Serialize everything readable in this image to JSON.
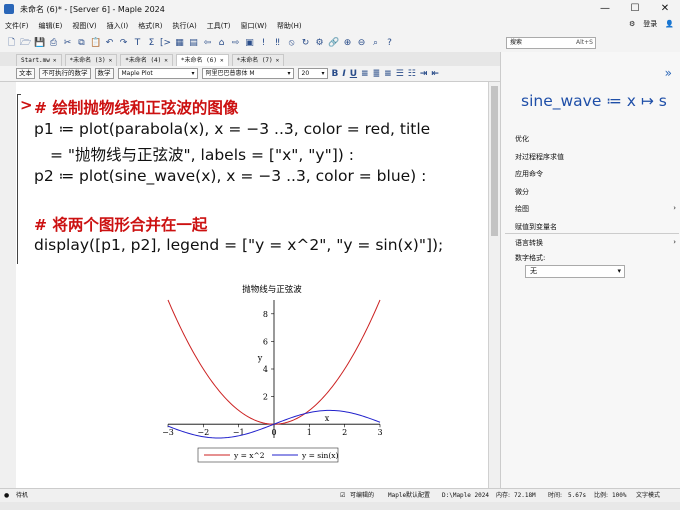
{
  "window": {
    "title": "未命名 (6)* - [Server 6] - Maple 2024",
    "minimize": "—",
    "maximize": "☐",
    "close": "✕"
  },
  "menu": [
    "文件(F)",
    "编辑(E)",
    "视图(V)",
    "插入(I)",
    "格式(R)",
    "执行(A)",
    "工具(T)",
    "窗口(W)",
    "帮助(H)"
  ],
  "menu_right": {
    "login": "登录"
  },
  "search": {
    "placeholder": "搜索",
    "shortcut": "Alt+S"
  },
  "tabs": [
    {
      "label": "Start.mw",
      "active": false
    },
    {
      "label": "*未命名 (3)",
      "active": false
    },
    {
      "label": "*未命名 (4)",
      "active": false
    },
    {
      "label": "*未命名 (6)",
      "active": true
    },
    {
      "label": "*未命名 (7)",
      "active": false
    }
  ],
  "format": {
    "text_btn": "文本",
    "nonexec_btn": "不可执行的数学",
    "math_btn": "数学",
    "style": "Maple Plot",
    "font": "阿里巴巴普惠体 M",
    "size": "20"
  },
  "document": {
    "prompt": ">",
    "line1": "# 绘制抛物线和正弦波的图像",
    "line2": "p1 ≔ plot(parabola(x), x = −3 ..3, color = red, title",
    "line3": "= \"抛物线与正弦波\", labels = [\"x\", \"y\"]) :",
    "line4": "p2 ≔ plot(sine_wave(x), x = −3 ..3, color = blue) :",
    "line5": "# 将两个图形合并在一起",
    "line6": "display([p1, p2], legend = [\"y = x^2\", \"y = sin(x)\"]);"
  },
  "chart_data": {
    "type": "line",
    "title": "抛物线与正弦波",
    "xlabel": "x",
    "ylabel": "y",
    "xlim": [
      -3,
      3
    ],
    "ylim": [
      -1,
      9
    ],
    "xticks": [
      -3,
      -2,
      -1,
      0,
      1,
      2,
      3
    ],
    "yticks": [
      2,
      4,
      6,
      8
    ],
    "series": [
      {
        "name": "y = x^2",
        "color": "#cc2222",
        "x": [
          -3,
          -2.5,
          -2,
          -1.5,
          -1,
          -0.5,
          0,
          0.5,
          1,
          1.5,
          2,
          2.5,
          3
        ],
        "y": [
          9,
          6.25,
          4,
          2.25,
          1,
          0.25,
          0,
          0.25,
          1,
          2.25,
          4,
          6.25,
          9
        ]
      },
      {
        "name": "y = sin(x)",
        "color": "#2222cc",
        "x": [
          -3,
          -2.5,
          -2,
          -1.5,
          -1,
          -0.5,
          0,
          0.5,
          1,
          1.5,
          2,
          2.5,
          3
        ],
        "y": [
          -0.141,
          -0.598,
          -0.909,
          -0.997,
          -0.841,
          -0.479,
          0,
          0.479,
          0.841,
          0.997,
          0.909,
          0.598,
          0.141
        ]
      }
    ],
    "legend": "bottom"
  },
  "panel": {
    "expr": "sine_wave ≔ x ↦ s",
    "items": [
      "优化",
      "对过程程序求值",
      "应用命令",
      "微分",
      "绘图",
      "赋值到变量名"
    ],
    "lang_convert": "语言转换",
    "num_format_label": "数字格式:",
    "num_format_value": "无"
  },
  "status": {
    "ready": "待机",
    "editable": "可编辑的",
    "config": "Maple默认配置",
    "path": "D:\\Maple 2024",
    "memory_label": "内存:",
    "memory_value": "72.18M",
    "time_label": "时间:",
    "time_value": "5.67s",
    "ratio_label": "比例:",
    "ratio_value": "100%",
    "mode": "文字模式"
  }
}
